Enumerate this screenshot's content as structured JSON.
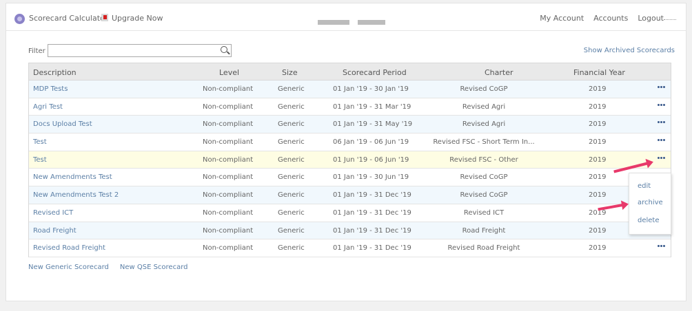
{
  "header": {
    "app_title": "Scorecard Calculator",
    "upgrade_label": "Upgrade Now",
    "nav": [
      "My Account",
      "Accounts",
      "Logout"
    ]
  },
  "filter": {
    "label": "Filter",
    "value": "",
    "archived_link": "Show Archived Scorecards"
  },
  "table": {
    "columns": [
      "Description",
      "Level",
      "Size",
      "Scorecard Period",
      "Charter",
      "Financial Year"
    ],
    "rows": [
      {
        "description": "MDP Tests",
        "level": "Non-compliant",
        "size": "Generic",
        "period": "01 Jan '19 - 30 Jan '19",
        "charter": "Revised CoGP",
        "year": "2019"
      },
      {
        "description": "Agri Test",
        "level": "Non-compliant",
        "size": "Generic",
        "period": "01 Jan '19 - 31 Mar '19",
        "charter": "Revised Agri",
        "year": "2019"
      },
      {
        "description": "Docs Upload Test",
        "level": "Non-compliant",
        "size": "Generic",
        "period": "01 Jan '19 - 31 May '19",
        "charter": "Revised Agri",
        "year": "2019"
      },
      {
        "description": "Test",
        "level": "Non-compliant",
        "size": "Generic",
        "period": "06 Jan '19 - 06 Jun '19",
        "charter": "Revised FSC - Short Term In...",
        "year": "2019"
      },
      {
        "description": "Test",
        "level": "Non-compliant",
        "size": "Generic",
        "period": "01 Jun '19 - 06 Jun '19",
        "charter": "Revised FSC - Other",
        "year": "2019"
      },
      {
        "description": "New Amendments Test",
        "level": "Non-compliant",
        "size": "Generic",
        "period": "01 Jan '19 - 30 Jun '19",
        "charter": "Revised CoGP",
        "year": "2019"
      },
      {
        "description": "New Amendments Test 2",
        "level": "Non-compliant",
        "size": "Generic",
        "period": "01 Jan '19 - 31 Dec '19",
        "charter": "Revised CoGP",
        "year": "2019"
      },
      {
        "description": "Revised ICT",
        "level": "Non-compliant",
        "size": "Generic",
        "period": "01 Jan '19 - 31 Dec '19",
        "charter": "Revised ICT",
        "year": "2019"
      },
      {
        "description": "Road Freight",
        "level": "Non-compliant",
        "size": "Generic",
        "period": "01 Jan '19 - 31 Dec '19",
        "charter": "Road Freight",
        "year": "2019"
      },
      {
        "description": "Revised Road Freight",
        "level": "Non-compliant",
        "size": "Generic",
        "period": "01 Jan '19 - 31 Dec '19",
        "charter": "Revised Road Freight",
        "year": "2019"
      }
    ]
  },
  "context_menu": {
    "items": [
      "edit",
      "archive",
      "delete"
    ]
  },
  "footer": {
    "new_generic": "New Generic Scorecard",
    "new_qse": "New QSE Scorecard"
  },
  "colors": {
    "link": "#5b7fa6",
    "row_alt": "#f1f8fd",
    "row_highlight": "#fefde3",
    "arrow": "#e8396a"
  }
}
